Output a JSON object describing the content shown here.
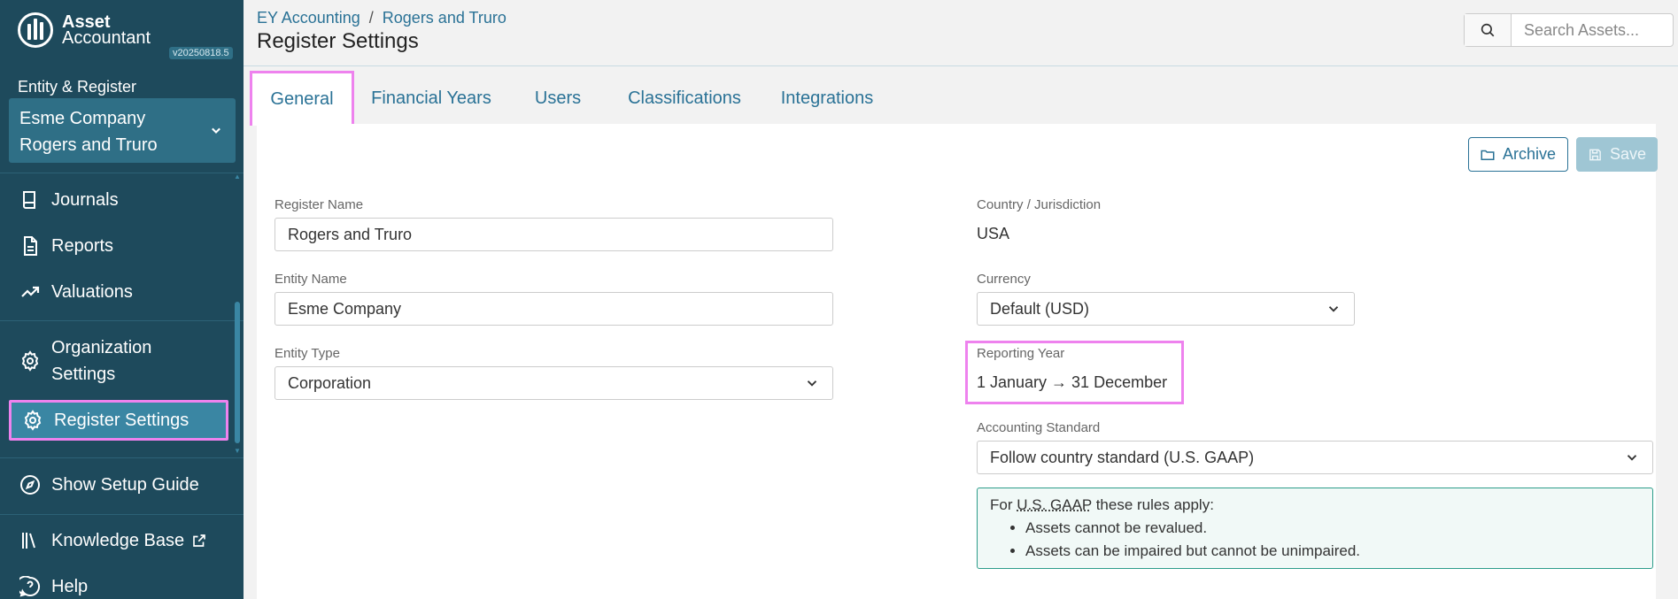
{
  "sidebar": {
    "logo_line1": "Asset",
    "logo_line2": "Accountant",
    "version": "v20250818.5",
    "entity_label": "Entity & Register",
    "entity_name": "Esme Company",
    "register_name": "Rogers and Truro",
    "items": [
      {
        "label": "Journals",
        "icon": "book-icon"
      },
      {
        "label": "Reports",
        "icon": "document-icon"
      },
      {
        "label": "Valuations",
        "icon": "trending-up-icon"
      },
      {
        "label_line1": "Organization",
        "label_line2": "Settings",
        "icon": "gear-icon"
      },
      {
        "label": "Register Settings",
        "icon": "gear-icon",
        "active": true
      },
      {
        "label": "Show Setup Guide",
        "icon": "compass-icon"
      },
      {
        "label": "Knowledge Base",
        "icon": "library-icon"
      },
      {
        "label": "Help",
        "icon": "help-icon"
      }
    ]
  },
  "header": {
    "breadcrumb": [
      "EY Accounting",
      "Rogers and Truro"
    ],
    "breadcrumb_sep": "/",
    "title": "Register Settings",
    "search_placeholder": "Search Assets..."
  },
  "tabs": [
    "General",
    "Financial Years",
    "Users",
    "Classifications",
    "Integrations"
  ],
  "actions": {
    "archive": "Archive",
    "save": "Save"
  },
  "form": {
    "register_name_label": "Register Name",
    "register_name_value": "Rogers and Truro",
    "entity_name_label": "Entity Name",
    "entity_name_value": "Esme Company",
    "entity_type_label": "Entity Type",
    "entity_type_value": "Corporation",
    "country_label": "Country / Jurisdiction",
    "country_value": "USA",
    "currency_label": "Currency",
    "currency_value": "Default (USD)",
    "reporting_year_label": "Reporting Year",
    "reporting_year_value": "1 January → 31 December",
    "standard_label": "Accounting Standard",
    "standard_value": "Follow country standard (U.S. GAAP)",
    "rules_prefix": "For",
    "rules_standard": "U.S. GAAP",
    "rules_suffix": "these rules apply:",
    "rules": [
      "Assets cannot be revalued.",
      "Assets can be impaired but cannot be unimpaired."
    ]
  },
  "colors": {
    "sidebar": "#1e4a5c",
    "accent": "#2a7296",
    "highlight": "#ee82ee"
  }
}
